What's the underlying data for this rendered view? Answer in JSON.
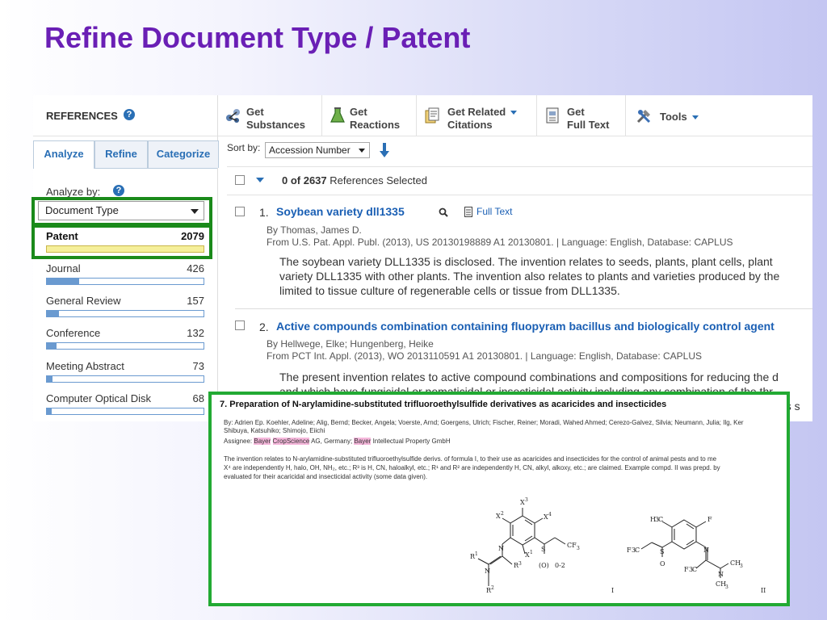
{
  "slide_title": "Refine Document Type / Patent",
  "sidebar": {
    "header": "REFERENCES",
    "tabs": [
      "Analyze",
      "Refine",
      "Categorize"
    ],
    "analyze_by_label": "Analyze by:",
    "analyze_by_value": "Document Type",
    "facets": [
      {
        "name": "Patent",
        "count": "2079",
        "fraction": 1.0,
        "selected": true
      },
      {
        "name": "Journal",
        "count": "426",
        "fraction": 0.205
      },
      {
        "name": "General Review",
        "count": "157",
        "fraction": 0.076
      },
      {
        "name": "Conference",
        "count": "132",
        "fraction": 0.063
      },
      {
        "name": "Meeting Abstract",
        "count": "73",
        "fraction": 0.035
      },
      {
        "name": "Computer Optical Disk",
        "count": "68",
        "fraction": 0.033
      }
    ]
  },
  "toolbar": {
    "get_substances_1": "Get",
    "get_substances_2": "Substances",
    "get_reactions_1": "Get",
    "get_reactions_2": "Reactions",
    "get_related_1": "Get Related",
    "get_related_2": "Citations",
    "get_fulltext_1": "Get",
    "get_fulltext_2": "Full Text",
    "tools": "Tools"
  },
  "sort": {
    "label": "Sort by:",
    "value": "Accession Number"
  },
  "selection": {
    "count": "0 of 2637",
    "suffix": "References Selected"
  },
  "results": [
    {
      "number": "1.",
      "title": "Soybean variety dll1335",
      "full_text": "Full Text",
      "authors": "By Thomas, James D.",
      "source": "From U.S. Pat. Appl. Publ. (2013), US 20130198889 A1 20130801.  |  Language: English, Database: CAPLUS",
      "abstract_1": "The soybean variety DLL1335 is disclosed.  The invention relates to seeds, plants, plant cells, plant",
      "abstract_2": "variety DLL1335 with other plants.  The invention also relates to plants and varieties produced by the",
      "abstract_3": "limited to tissue culture of regenerable cells or tissue from DLL1335."
    },
    {
      "number": "2.",
      "title": "Active compounds combination containing fluopyram bacillus and biologically control agent",
      "authors": "By Hellwege, Elke; Hungenberg, Heike",
      "source": "From PCT Int. Appl. (2013), WO 2013110591 A1 20130801.  |  Language: English, Database: CAPLUS",
      "abstract_1": "The present invention relates to active compound combinations and compositions for reducing the d",
      "abstract_2": "and which have fungicidal or nematicidal or insecticidal activity including any combination of the thr",
      "abstract_tail": "us s"
    }
  ],
  "overlay": {
    "title": "7.  Preparation of N-arylamidine-substituted trifluoroethylsulfide derivatives as acaricides and insecticides",
    "authors_1": "By: Adrien Ep. Koehler, Adeline; Alig, Bernd; Becker, Angela; Voerste, Arnd; Goergens, Ulrich; Fischer, Reiner; Moradi, Wahed Ahmed; Cerezo-Galvez, Silvia; Neumann, Julia; Ilg, Ker",
    "authors_2": "Shibuya, Katsuhiko; Shimojo, Eiichi",
    "assignee_prefix": "Assignee: ",
    "assignee_bayer1": "Bayer",
    "assignee_crop": "CropScience",
    "assignee_mid": " AG, Germany; ",
    "assignee_bayer2": "Bayer",
    "assignee_suffix": " Intellectual Property GmbH",
    "abstract_1": "The invention relates to N-arylamidine-substituted trifluoroethylsulfide derivs. of formula I, to their use as acaricides and insecticides for the control of animal pests and to me",
    "abstract_2": "X⁴ are independently H, halo, OH, NH₂, etc.; R³ is H, CN, haloalkyl, etc.; R¹ and R² are independently H, CN, alkyl, alkoxy, etc.; are claimed.  Example compd. II was prepd. by",
    "abstract_3": "evaluated for their acaricidal and insecticidal activity (some data given).",
    "label_I": "I",
    "label_II": "II"
  }
}
